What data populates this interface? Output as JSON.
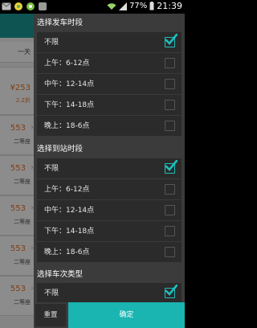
{
  "status_bar": {
    "battery": "77%",
    "time": "21:39"
  },
  "background_list": {
    "date_fragment": "一天",
    "cards": [
      {
        "price": "¥253",
        "discount": "2.2折"
      },
      {
        "price": "553",
        "seat": "二等座"
      },
      {
        "price": "553",
        "seat": "二等座"
      },
      {
        "price": "553",
        "seat": "二等座"
      },
      {
        "price": "553",
        "seat": "二等座"
      },
      {
        "price": "553",
        "seat": "二等座"
      }
    ]
  },
  "filters": {
    "departure": {
      "title": "选择发车时段",
      "options": [
        {
          "label": "不限",
          "checked": true
        },
        {
          "label": "上午：6-12点",
          "checked": false
        },
        {
          "label": "中午：12-14点",
          "checked": false
        },
        {
          "label": "下午：14-18点",
          "checked": false
        },
        {
          "label": "晚上：18-6点",
          "checked": false
        }
      ]
    },
    "arrival": {
      "title": "选择到站时段",
      "options": [
        {
          "label": "不限",
          "checked": true
        },
        {
          "label": "上午：6-12点",
          "checked": false
        },
        {
          "label": "中午：12-14点",
          "checked": false
        },
        {
          "label": "下午：14-18点",
          "checked": false
        },
        {
          "label": "晚上：18-6点",
          "checked": false
        }
      ]
    },
    "train_type": {
      "title": "选择车次类型",
      "options": [
        {
          "label": "不限",
          "checked": true
        }
      ]
    }
  },
  "footer": {
    "reset_label": "重置",
    "confirm_label": "确定"
  },
  "colors": {
    "accent": "#1ebfbd",
    "price": "#f0721f",
    "drawer_bg": "#3b3b3b",
    "option_bg": "#2b2b2b"
  }
}
